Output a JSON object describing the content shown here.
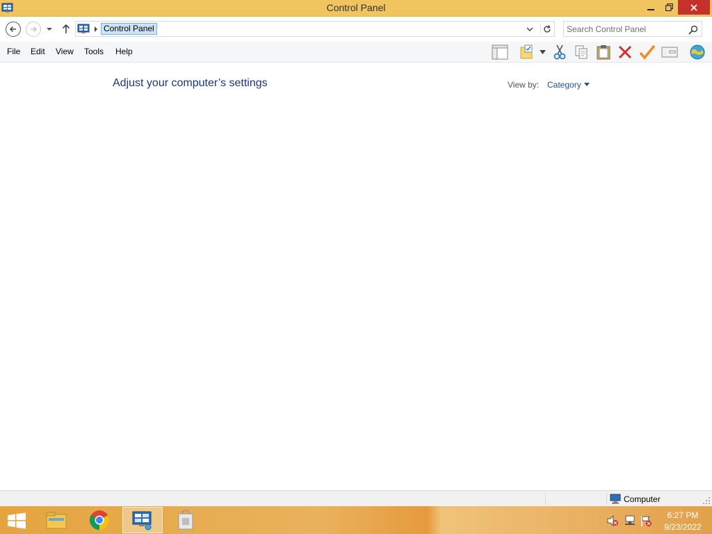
{
  "window": {
    "title": "Control Panel",
    "minimize_icon": "minimize-icon",
    "maximize_icon": "restore-icon",
    "close_icon": "close-icon"
  },
  "address_bar": {
    "breadcrumb": "Control Panel",
    "search_placeholder": "Search Control Panel"
  },
  "menu": {
    "file": "File",
    "edit": "Edit",
    "view": "View",
    "tools": "Tools",
    "help": "Help"
  },
  "toolbar_icons": [
    "preview-pane-icon",
    "folder-check-icon",
    "cut-icon",
    "copy-icon",
    "paste-icon",
    "delete-icon",
    "checkmark-icon",
    "properties-icon",
    "globe-icon"
  ],
  "content": {
    "title": "Adjust your computer’s settings",
    "view_by_label": "View by:",
    "view_by_value": "Category"
  },
  "status_bar": {
    "location": "Computer"
  },
  "taskbar": {
    "apps": [
      "file-explorer-icon",
      "chrome-icon",
      "control-panel-icon",
      "store-icon"
    ],
    "time": "6:27 PM",
    "date": "9/23/2022"
  },
  "colors": {
    "title_bar": "#f0c45e",
    "close_button": "#c7312b",
    "link": "#1e3287",
    "taskbar": "#e4a440"
  }
}
